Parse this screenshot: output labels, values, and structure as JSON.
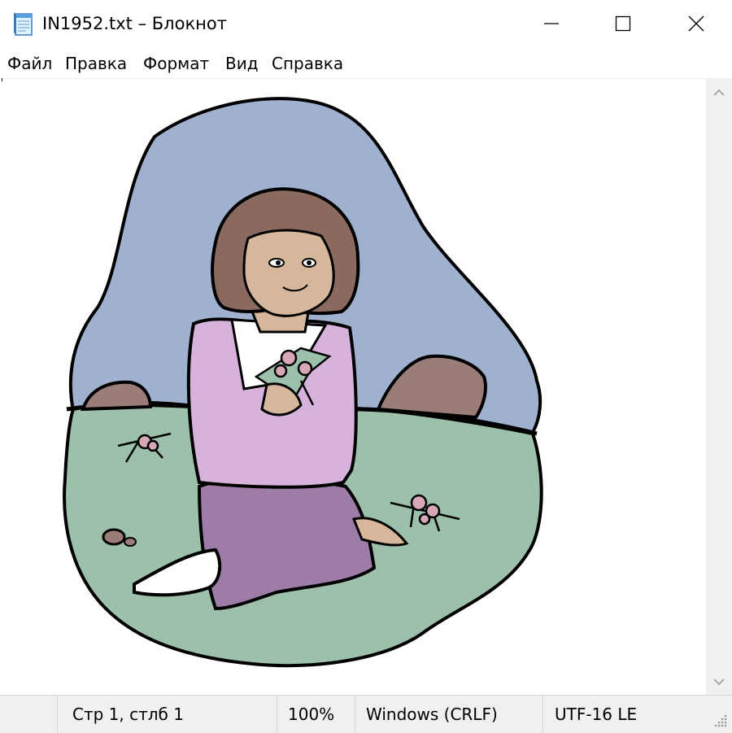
{
  "window": {
    "title": "IN1952.txt – Блокнот",
    "icons": {
      "app": "notepad-icon",
      "minimize": "minimize-icon",
      "maximize": "maximize-icon",
      "close": "close-icon"
    }
  },
  "menu": {
    "items": [
      "Файл",
      "Правка",
      "Формат",
      "Вид",
      "Справка"
    ]
  },
  "editor": {
    "content_description": "",
    "art_icon": "girl-with-flowers-clipart"
  },
  "scrollbar": {
    "up_icon": "chevron-up-icon",
    "down_icon": "chevron-down-icon"
  },
  "status": {
    "position": "Стр 1, стлб 1",
    "zoom": "100%",
    "line_endings": "Windows (CRLF)",
    "encoding": "UTF-16 LE"
  },
  "colors": {
    "sky": "#9fb1cf",
    "grass": "#9cc0a9",
    "hair": "#8a6a5e",
    "skin": "#d7b79b",
    "shirt": "#d7b3dc",
    "pants": "#9d7da8",
    "rock": "#9a7d78"
  }
}
